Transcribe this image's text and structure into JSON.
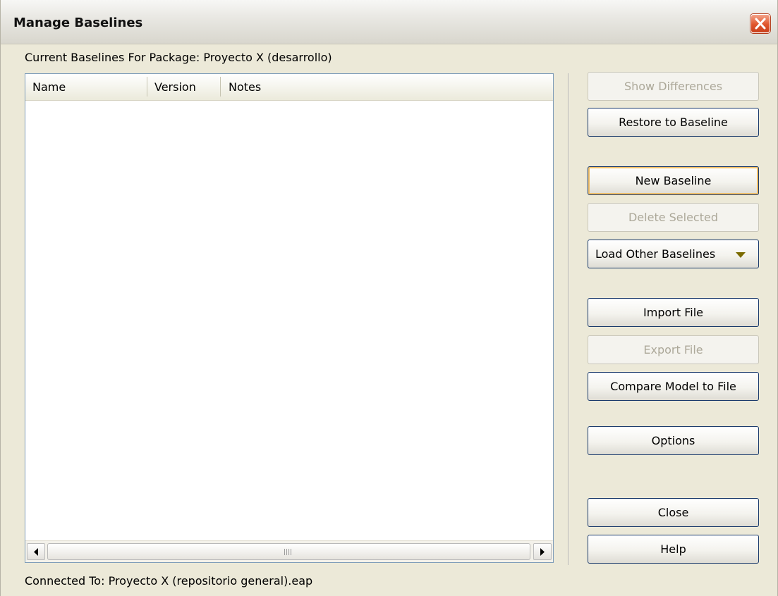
{
  "window": {
    "title": "Manage Baselines",
    "close_icon": "close-icon"
  },
  "package_label": "Current Baselines For Package: Proyecto X (desarrollo)",
  "list": {
    "columns": [
      "Name",
      "Version",
      "Notes"
    ],
    "rows": [],
    "scrollbar": {
      "left_icon": "scroll-left-icon",
      "right_icon": "scroll-right-icon"
    }
  },
  "buttons": {
    "show_differences": "Show Differences",
    "restore_to_baseline": "Restore to Baseline",
    "new_baseline": "New Baseline",
    "delete_selected": "Delete Selected",
    "load_other_baselines": "Load Other Baselines",
    "import_file": "Import File",
    "export_file": "Export File",
    "compare_model_to_file": "Compare Model to File",
    "options": "Options",
    "close": "Close",
    "help": "Help"
  },
  "status": {
    "connected": "Connected To: Proyecto X (repositorio general).eap"
  },
  "colors": {
    "close_button": "#e0562c",
    "dropdown_arrow": "#7a6a00",
    "default_focus": "#f1c06a"
  }
}
